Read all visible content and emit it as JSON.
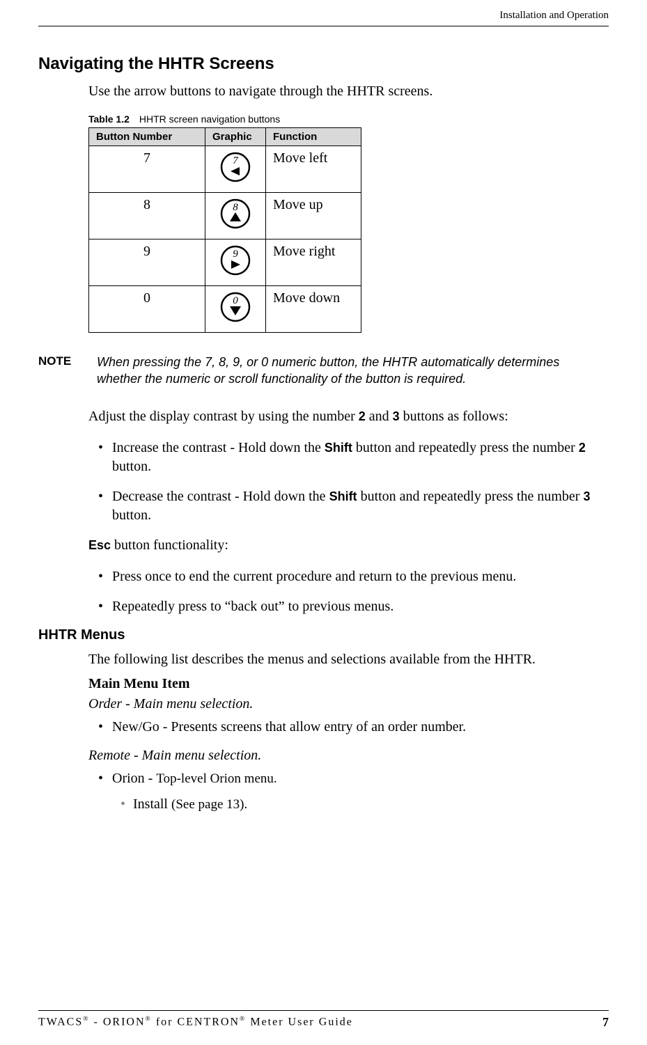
{
  "header": {
    "running": "Installation and Operation"
  },
  "section1": {
    "title": "Navigating the HHTR Screens",
    "intro": "Use the arrow buttons to navigate through the HHTR screens.",
    "table": {
      "caption_label": "Table 1.2",
      "caption_text": "HHTR screen navigation buttons",
      "headers": {
        "c1": "Button Number",
        "c2": "Graphic",
        "c3": "Function"
      },
      "rows": [
        {
          "num": "7",
          "glyph": "7",
          "dir": "left",
          "func": "Move left"
        },
        {
          "num": "8",
          "glyph": "8",
          "dir": "up",
          "func": "Move up"
        },
        {
          "num": "9",
          "glyph": "9",
          "dir": "right",
          "func": "Move right"
        },
        {
          "num": "0",
          "glyph": "0",
          "dir": "down",
          "func": "Move down"
        }
      ]
    },
    "note": {
      "label": "NOTE",
      "text": "When pressing the 7, 8, 9, or 0 numeric button, the HHTR automatically determines whether the numeric or scroll functionality of the button is required."
    },
    "contrast_intro_pre": "Adjust the display contrast by using the number ",
    "contrast_intro_b1": "2",
    "contrast_intro_mid": " and ",
    "contrast_intro_b2": "3",
    "contrast_intro_post": " buttons as follows:",
    "contrast_items": [
      {
        "pre": "Increase the contrast - Hold down the ",
        "shift": "Shift",
        "mid": " button and repeatedly press the number ",
        "num": "2",
        "post": " button."
      },
      {
        "pre": "Decrease the contrast - Hold down the ",
        "shift": "Shift",
        "mid": " button and repeatedly press the number ",
        "num": "3",
        "post": " button."
      }
    ],
    "esc_label": "Esc",
    "esc_rest": " button functionality:",
    "esc_items": [
      "Press once to end the current procedure and return to the previous menu.",
      "Repeatedly press to “back out” to previous menus."
    ]
  },
  "section2": {
    "title": "HHTR Menus",
    "intro": "The following list describes the menus and selections available from the HHTR.",
    "main_head": "Main Menu Item",
    "order_sel": "Order - Main menu selection.",
    "order_item": "New/Go - Presents screens that allow entry of an order number.",
    "remote_sel": "Remote - Main menu selection.",
    "orion_prefix": "Orion - ",
    "orion_rest": "Top-level Orion menu.",
    "install_prefix": "Install ",
    "install_rest": "(See page 13)."
  },
  "footer": {
    "t1": "TWACS",
    "t2": " - ORION",
    "t3": " for CENTRON",
    "t4": " Meter User Guide",
    "reg": "®",
    "page": "7"
  }
}
